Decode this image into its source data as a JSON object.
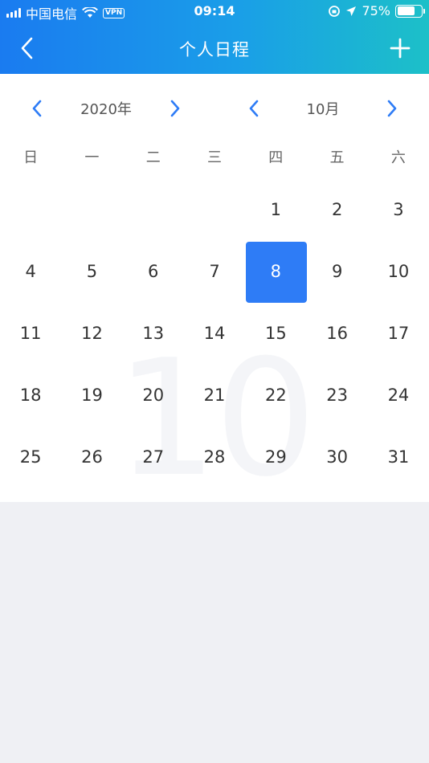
{
  "status_bar": {
    "carrier": "中国电信",
    "vpn": "VPN",
    "time": "09:14",
    "battery_percent": "75%",
    "battery_level": 0.75
  },
  "nav": {
    "title": "个人日程",
    "back_icon": "chevron-left-icon",
    "add_icon": "plus-icon"
  },
  "selector": {
    "year_label": "2020年",
    "month_label": "10月"
  },
  "weekdays": [
    "日",
    "一",
    "二",
    "三",
    "四",
    "五",
    "六"
  ],
  "month_watermark": "10",
  "days": {
    "leading_blanks": 4,
    "list": [
      "1",
      "2",
      "3",
      "4",
      "5",
      "6",
      "7",
      "8",
      "9",
      "10",
      "11",
      "12",
      "13",
      "14",
      "15",
      "16",
      "17",
      "18",
      "19",
      "20",
      "21",
      "22",
      "23",
      "24",
      "25",
      "26",
      "27",
      "28",
      "29",
      "30",
      "31"
    ],
    "selected": "8"
  },
  "colors": {
    "accent": "#2e7cf6",
    "header_gradient_start": "#1a7bf0",
    "header_gradient_end": "#1cc0c8"
  }
}
